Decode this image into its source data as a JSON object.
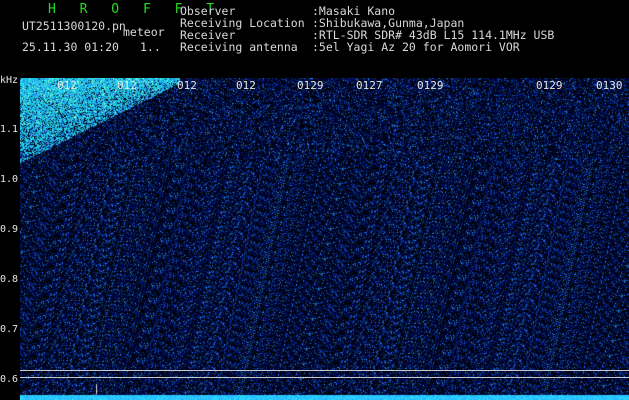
{
  "header": {
    "app_title": "H R O F F T",
    "filename": "UT2511300120.pn",
    "meteor_label": "meteor",
    "datetime": "25.11.30 01:20",
    "counter": "1.."
  },
  "info": {
    "observer_label": "Observer",
    "observer_value": ":Masaki Kano",
    "location_label": "Receiving Location",
    "location_value": ":Shibukawa,Gunma,Japan",
    "receiver_label": "Receiver",
    "receiver_value": ":RTL-SDR SDR# 43dB L15 114.1MHz USB",
    "antenna_label": "Receiving antenna",
    "antenna_value": ":5el Yagi Az 20 for Aomori VOR"
  },
  "axis": {
    "unit": "kHz",
    "y_labels": [
      "1.1",
      "1.0",
      "0.9",
      "0.8",
      "0.7",
      "0.6"
    ],
    "x_ticks": [
      "012",
      "012",
      "012",
      "012",
      "0129",
      "0127",
      "0129",
      "0129",
      "0130"
    ]
  },
  "colors": {
    "background": "#000000",
    "noise_dark": "#000a3c",
    "noise_bright": "#3b7bff",
    "signal": "#2fd6ff",
    "title_green": "#22dd22"
  }
}
